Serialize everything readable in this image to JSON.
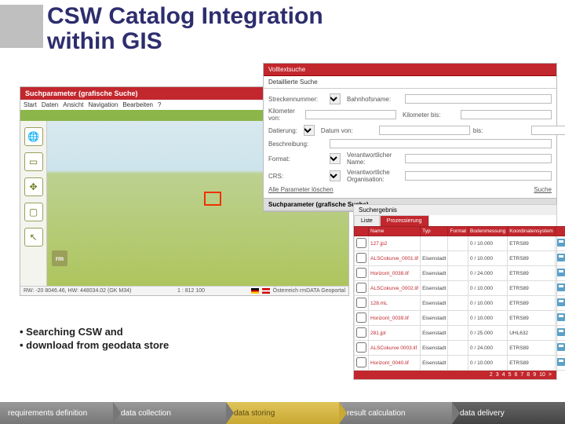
{
  "title": {
    "line1": "CSW Catalog Integration",
    "line2": "within GIS"
  },
  "gis": {
    "header": "Suchparameter (grafische Suche)",
    "menu": [
      "Start",
      "Daten",
      "Ansicht",
      "Navigation",
      "Bearbeiten",
      "?"
    ],
    "status_left": "RW: -20 8046.46, HW: 448034.02 (GK M34)",
    "status_mid": "1 : 812 100",
    "status_flags": "Österreich   rmDATA Geoportal",
    "logo": "rm"
  },
  "search": {
    "tab_volltext": "Volltextsuche",
    "tab_detail": "Detaillierte Suche",
    "fields": {
      "strecke": "Streckennummer:",
      "bahnhof": "Bahnhofsname:",
      "km_von": "Kilometer von:",
      "km_bis": "Kilometer bis:",
      "datierung": "Datierung:",
      "datum_von": "Datum von:",
      "bis": "bis:",
      "beschreibung": "Beschreibung:",
      "format": "Format:",
      "verant_name": "Verantwortlicher Name:",
      "crs": "CRS:",
      "verant_org": "Verantwortliche Organisation:"
    },
    "clear": "Alle Parameter löschen",
    "submit": "Suche",
    "graf_bar": "Suchparameter (grafische Suche)"
  },
  "results": {
    "head": "Suchergebnis",
    "tabs": {
      "list": "Liste",
      "proc": "Prozessierung"
    },
    "cols": [
      "",
      "Name",
      "Typ",
      "Format",
      "Bodenmessung",
      "Koordinatensystem",
      "",
      ""
    ],
    "rows": [
      {
        "name": "127.jp2",
        "typ": "",
        "fmt": "",
        "bod": "0 / 10.000",
        "crs": "ETRS89"
      },
      {
        "name": "ALSCokurve_0001.lif",
        "typ": "Eisenstadt",
        "fmt": "",
        "bod": "0 / 10.000",
        "crs": "ETRS89"
      },
      {
        "name": "Horizont_0038.lif",
        "typ": "Eisenstadt",
        "fmt": "",
        "bod": "0 / 24.000",
        "crs": "ETRS89"
      },
      {
        "name": "ALSCokurve_0002.lif",
        "typ": "Eisenstadt",
        "fmt": "",
        "bod": "0 / 10.000",
        "crs": "ETRS89"
      },
      {
        "name": "128.mL",
        "typ": "Eisenstadt",
        "fmt": "",
        "bod": "0 / 10.000",
        "crs": "ETRS89"
      },
      {
        "name": "Horizont_0039.lif",
        "typ": "Eisenstadt",
        "fmt": "",
        "bod": "0 / 10.000",
        "crs": "ETRS89"
      },
      {
        "name": "281.jpt",
        "typ": "Eisenstadt",
        "fmt": "",
        "bod": "0 / 25.000",
        "crs": "UHL632"
      },
      {
        "name": "ALSCokurve 0003.lif",
        "typ": "Eisenstadt",
        "fmt": "",
        "bod": "0 / 24.000",
        "crs": "ETRS89"
      },
      {
        "name": "Horizont_0040.lif",
        "typ": "Eisenstadt",
        "fmt": "",
        "bod": "0 / 10.000",
        "crs": "ETRS89"
      }
    ],
    "pager": [
      "2",
      "3",
      "4",
      "5",
      "6",
      "7",
      "8",
      "9",
      "10",
      ">"
    ]
  },
  "bullets": {
    "b1": "Searching CSW and",
    "b2": "download from geodata store"
  },
  "footer": {
    "s1": "requirements definition",
    "s2": "data collection",
    "s3": "data storing",
    "s4": "result calculation",
    "s5": "data delivery"
  }
}
